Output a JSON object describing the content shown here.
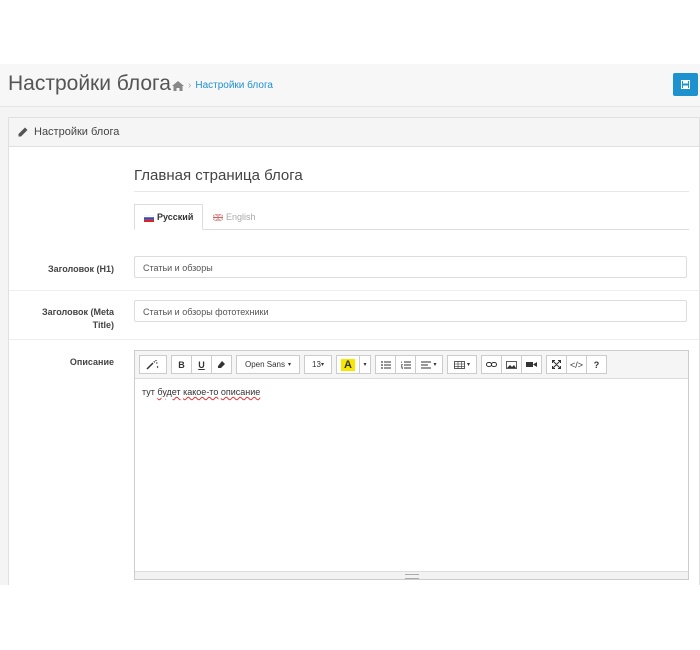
{
  "header": {
    "title": "Настройки блога",
    "breadcrumb_sep": "›",
    "breadcrumb_link": "Настройки блога"
  },
  "panel": {
    "heading": "Настройки блога",
    "section_title": "Главная страница блога",
    "tabs": [
      {
        "label": "Русский",
        "active": true
      },
      {
        "label": "English",
        "active": false
      }
    ]
  },
  "form": {
    "h1_label": "Заголовок (H1)",
    "h1_value": "Статьи и обзоры",
    "meta_label_line1": "Заголовок (Meta",
    "meta_label_line2": "Title)",
    "meta_value": "Статьи и обзоры фототехники",
    "desc_label": "Описание"
  },
  "editor": {
    "font_family": "Open Sans",
    "font_size": "13",
    "text_pre": "тут ",
    "text_word1": "будет",
    "text_mid": " ",
    "text_word2": "какое-то",
    "text_mid2": " ",
    "text_word3": "описание",
    "bold": "B",
    "underline": "U",
    "color_letter": "A",
    "help": "?",
    "code": "</>"
  },
  "colors": {
    "primary": "#1e91cf",
    "highlight": "#f7e600"
  }
}
